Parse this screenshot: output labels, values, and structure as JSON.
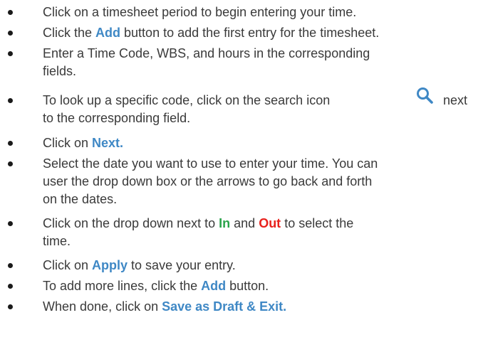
{
  "steps": [
    {
      "text": "Click on a timesheet period to begin entering your time."
    },
    {
      "pre": "Click the ",
      "hl": "Add",
      "post": " button to add the first entry for the timesheet."
    },
    {
      "line1": "Enter a Time Code, WBS, and hours in the corresponding",
      "line2": "fields."
    },
    {
      "line1": "To look up a specific code, click on the search icon",
      "line1_after": "next",
      "line2": "to the corresponding field.",
      "icon": "search-icon"
    },
    {
      "pre": "Click on ",
      "hl": "Next."
    },
    {
      "line1": "Select the date you want to use to enter your time. You can",
      "line2": "user the drop down box or the arrows to go back and forth",
      "line3": "on the dates."
    },
    {
      "pre": "Click on the drop down next to ",
      "in": "In",
      "mid": " and ",
      "out": "Out",
      "post": " to select the",
      "line2": "time."
    },
    {
      "pre": "Click on ",
      "hl": "Apply",
      "post": " to save your entry."
    },
    {
      "pre": "To add more lines, click the ",
      "hl": "Add",
      "post": " button."
    },
    {
      "pre": "When done, click on ",
      "hl": "Save as Draft & Exit."
    }
  ],
  "colors": {
    "text": "#3a3a3a",
    "action_blue": "#3f88c5",
    "in_green": "#2aa34a",
    "out_red": "#e8211c"
  }
}
